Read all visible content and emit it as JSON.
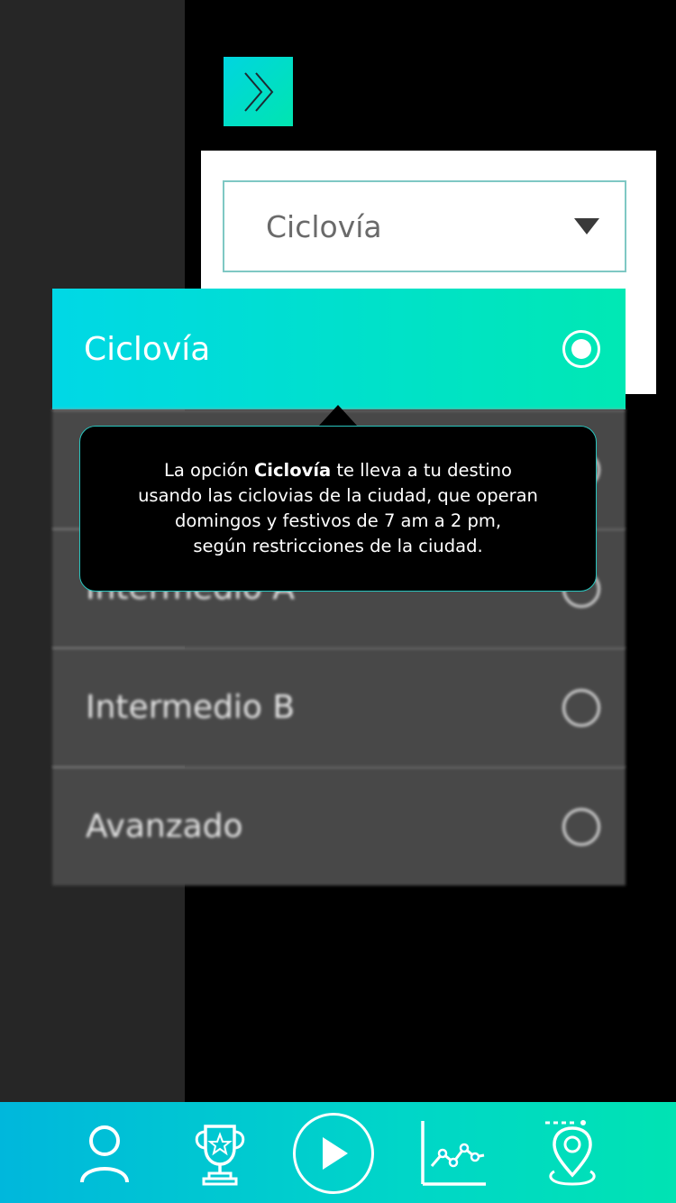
{
  "dropdown": {
    "selected": "Ciclovía"
  },
  "options": [
    {
      "label": "Ciclovía",
      "selected": true
    },
    {
      "label": "Intermedio A",
      "selected": false
    },
    {
      "label": "Intermedio B",
      "selected": false
    },
    {
      "label": "Avanzado",
      "selected": false
    }
  ],
  "tooltip": {
    "line1_pre": "La opción ",
    "line1_bold": "Ciclovía",
    "line1_post": " te lleva a tu destino",
    "line2": "usando las ciclovias de la ciudad, que operan",
    "line3": "domingos y festivos de 7 am a 2 pm,",
    "line4": "según restricciones de la ciudad."
  },
  "nav": {
    "items": [
      "profile-icon",
      "trophy-icon",
      "play-icon",
      "stats-chart-icon",
      "route-location-icon"
    ]
  },
  "colors": {
    "accent_start": "#00d5e0",
    "accent_end": "#00e5b0",
    "tooltip_border": "#29c5be"
  }
}
